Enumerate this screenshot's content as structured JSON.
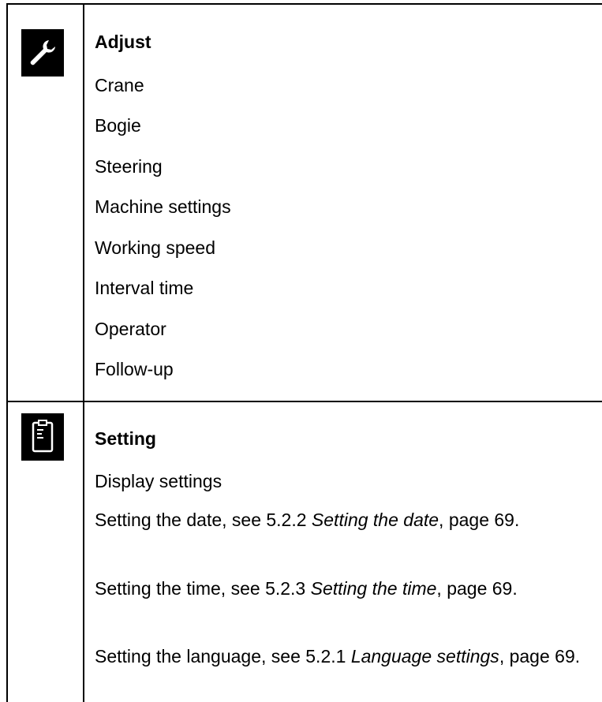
{
  "sections": {
    "adjust": {
      "icon": "wrench-icon",
      "heading": "Adjust",
      "items": [
        "Crane",
        "Bogie",
        "Steering",
        "Machine settings",
        "Working speed",
        "Interval time",
        "Operator",
        "Follow-up"
      ]
    },
    "setting": {
      "icon": "clipboard-icon",
      "heading": "Setting",
      "display_settings": "Display settings",
      "date": {
        "prefix": "Setting the date, see 5.2.2 ",
        "ref": "Setting the date",
        "suffix": ", page 69."
      },
      "time": {
        "prefix": "Setting the time, see 5.2.3 ",
        "ref": "Setting the time",
        "suffix": ", page 69."
      },
      "language": {
        "prefix": "Setting the language, see 5.2.1 ",
        "ref": "Language settings",
        "suffix": ", page 69."
      }
    }
  }
}
